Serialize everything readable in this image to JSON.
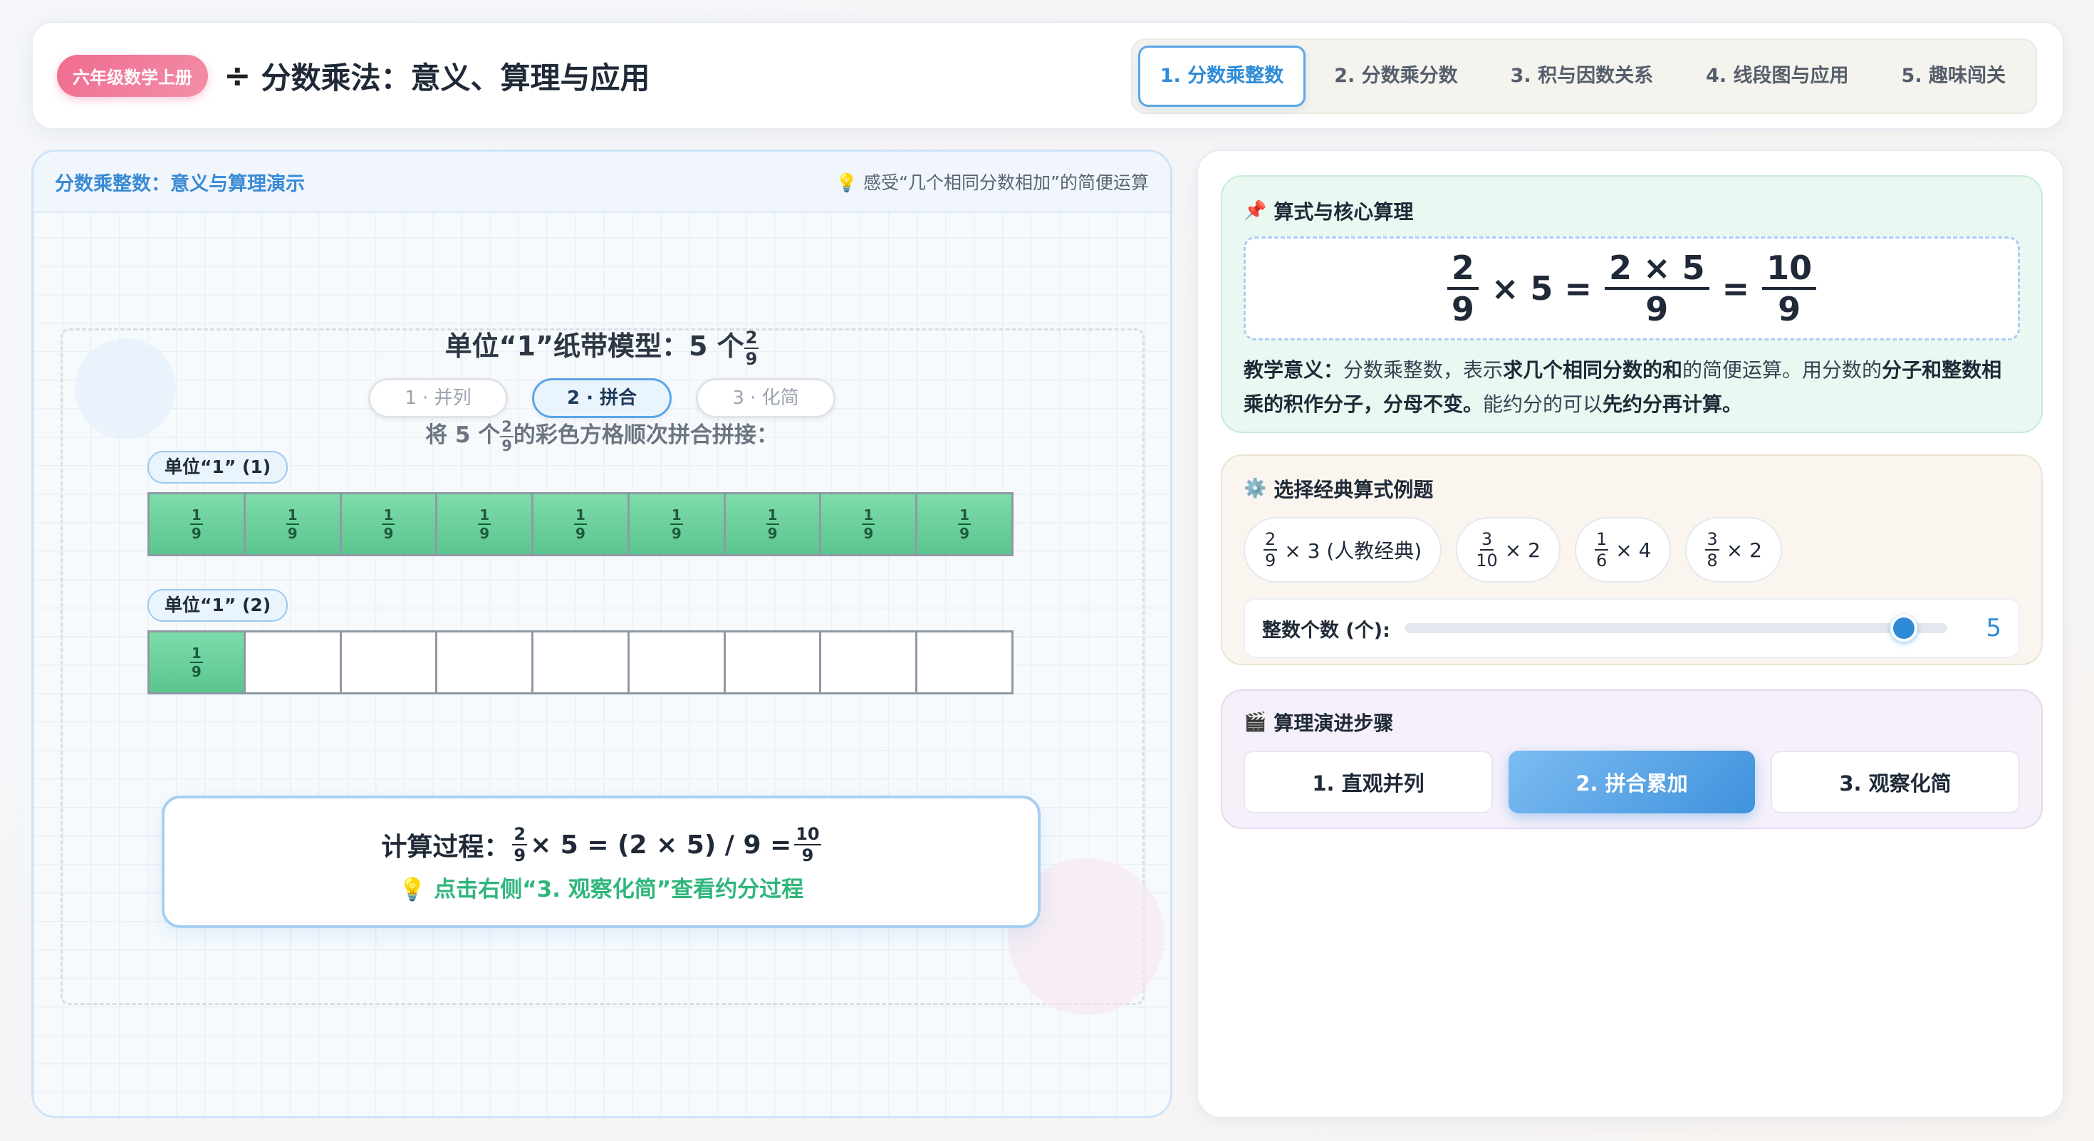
{
  "header": {
    "badge": "六年级数学上册",
    "icon": "÷",
    "title": "分数乘法：意义、算理与应用",
    "tabs": [
      {
        "label": "1. 分数乘整数",
        "active": true
      },
      {
        "label": "2. 分数乘分数",
        "active": false
      },
      {
        "label": "3. 积与因数关系",
        "active": false
      },
      {
        "label": "4. 线段图与应用",
        "active": false
      },
      {
        "label": "5. 趣味闯关",
        "active": false
      }
    ]
  },
  "left": {
    "title": "分数乘整数：意义与算理演示",
    "hint": "💡 感受“几个相同分数相加”的简便运算",
    "model_title_prefix": "单位“1”纸带模型：5 个",
    "model_frac": {
      "n": "2",
      "d": "9"
    },
    "steps": [
      "1 · 并列",
      "2 · 拼合",
      "3 · 化简"
    ],
    "active_step": 1,
    "instruction_prefix": "将 5 个",
    "instruction_suffix": "的彩色方格顺次拼合拼接：",
    "bars": [
      {
        "label": "单位“1” (1)",
        "cells": 9,
        "filled": 9,
        "cell_n": "1",
        "cell_d": "9"
      },
      {
        "label": "单位“1” (2)",
        "cells": 9,
        "filled": 1,
        "cell_n": "1",
        "cell_d": "9"
      }
    ],
    "calc": {
      "prefix": "计算过程：",
      "f1": {
        "n": "2",
        "d": "9"
      },
      "middle": "× 5 = (2 × 5) / 9 =",
      "f2": {
        "n": "10",
        "d": "9"
      },
      "tip": "💡 点击右侧“3. 观察化简”查看约分过程"
    }
  },
  "right": {
    "formula_card": {
      "icon": "📌",
      "title": "算式与核心算理",
      "lhs": {
        "n": "2",
        "d": "9"
      },
      "times": "× 5 =",
      "mid": {
        "n": "2 × 5",
        "d": "9"
      },
      "eq": "=",
      "result": {
        "n": "10",
        "d": "9"
      },
      "meaning_label": "教学意义：",
      "meaning_1": "分数乘整数，表示",
      "meaning_2": "求几个相同分数的和",
      "meaning_3": "的简便运算。用分数的",
      "meaning_4": "分子和整数相乘的积作分子，分母不变。",
      "meaning_5": "能约分的可以",
      "meaning_6": "先约分再计算。"
    },
    "examples_card": {
      "icon": "⚙️",
      "title": "选择经典算式例题",
      "examples": [
        {
          "n": "2",
          "d": "9",
          "rest": "× 3 (人教经典)"
        },
        {
          "n": "3",
          "d": "10",
          "rest": "× 2"
        },
        {
          "n": "1",
          "d": "6",
          "rest": "× 4"
        },
        {
          "n": "3",
          "d": "8",
          "rest": "× 2"
        }
      ],
      "slider_label": "整数个数 (个):",
      "slider_value": "5",
      "slider_fraction": 0.92
    },
    "steps_card": {
      "icon": "🎬",
      "title": "算理演进步骤",
      "steps": [
        "1. 直观并列",
        "2. 拼合累加",
        "3. 观察化简"
      ],
      "active": 1
    }
  }
}
